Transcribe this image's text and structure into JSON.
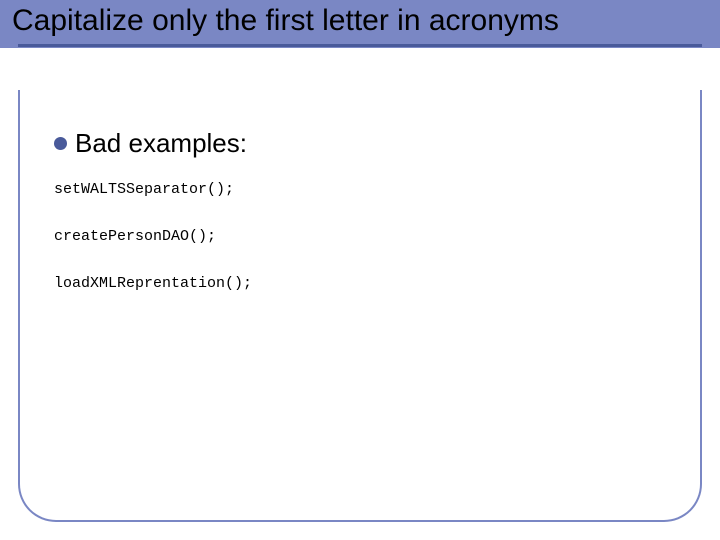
{
  "title": "Capitalize only the first letter in acronyms",
  "bullet": {
    "label": "Bad examples:"
  },
  "code_lines": [
    "setWALTSSeparator();",
    "createPersonDAO();",
    "loadXMLReprentation();"
  ]
}
